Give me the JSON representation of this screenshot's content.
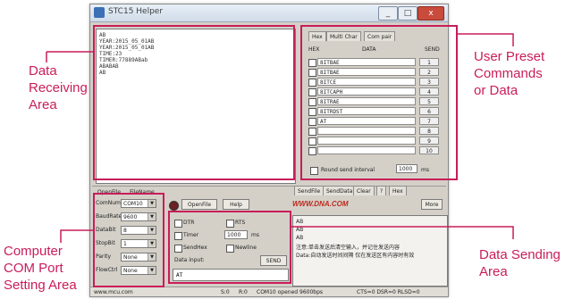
{
  "window": {
    "title": "STC15 Helper",
    "minimize": "_",
    "maximize": "□",
    "close": "x"
  },
  "receive": {
    "lines": [
      "AB",
      "YEAR:2015_05_01AB",
      "YEAR:2015_05_01AB",
      "TIME:23",
      "TIMER:77889ABab",
      "ABABAB",
      "AB"
    ]
  },
  "preset": {
    "tabs": [
      "Hex",
      "Multi Char",
      "Com pair"
    ],
    "header": {
      "hex": "HEX",
      "data": "DATA",
      "send": "SEND"
    },
    "rows": [
      {
        "text": "8ITBAE",
        "n": "1"
      },
      {
        "text": "8ITBAE",
        "n": "2"
      },
      {
        "text": "8ITCE",
        "n": "3"
      },
      {
        "text": "8ITCAPH",
        "n": "4"
      },
      {
        "text": "8ITRAE",
        "n": "5"
      },
      {
        "text": "8ITRDST",
        "n": "6"
      },
      {
        "text": "AT",
        "n": "7"
      },
      {
        "text": "",
        "n": "8"
      },
      {
        "text": "",
        "n": "9"
      },
      {
        "text": "",
        "n": "10"
      }
    ],
    "loop_label": "Round send interval",
    "loop_value": "1000",
    "loop_unit": "ms"
  },
  "middle_bar": {
    "left_label": "OpenFile",
    "right_label": "FileName",
    "open_button": "OpenFile",
    "help_button": "Help",
    "logo": "WWW.DNA.COM",
    "more_button": "More",
    "tabs": [
      "SendFile",
      "SendData",
      "Clear",
      "?",
      "Hex"
    ]
  },
  "com_settings": {
    "rows": [
      {
        "label": "ComNum",
        "value": "COM10"
      },
      {
        "label": "BaudRate",
        "value": "9600"
      },
      {
        "label": "DataBit",
        "value": "8"
      },
      {
        "label": "StopBit",
        "value": "1"
      },
      {
        "label": "Parity",
        "value": "None"
      },
      {
        "label": "FlowCtrl",
        "value": "None"
      }
    ]
  },
  "send_options": {
    "dtr": "DTR",
    "rts": "RTS",
    "timer": "Timer",
    "timer_value": "1000",
    "timer_unit": "ms",
    "sendhex": "SendHex",
    "newline": "Newline",
    "data_input": "Data input:",
    "send_button": "SEND",
    "send_text": "AT",
    "notes": [
      "AB",
      "AB",
      "AB",
      "注意:单击发送后清空输入，并记住发送内容",
      "Data:自动发送时间间隔 仅在发送区有内容时有效"
    ]
  },
  "status": {
    "items": [
      "www.mcu.com",
      "COM10 opened 9600bps",
      "S:0",
      "R:0",
      "CTS=0 DSR=0 RLSD=0"
    ]
  },
  "annotations": {
    "receive": [
      "Data",
      "Receiving",
      "Area"
    ],
    "preset": [
      "User Preset",
      "Commands",
      "or Data"
    ],
    "com": [
      "Computer",
      "COM Port",
      "Setting Area"
    ],
    "send": [
      "Data Sending",
      "Area"
    ]
  }
}
